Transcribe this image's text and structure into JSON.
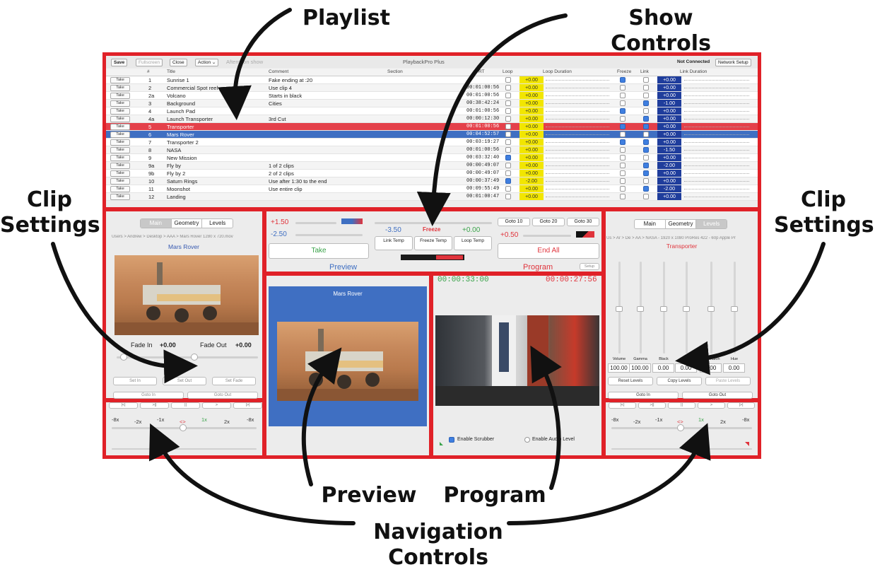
{
  "callouts": {
    "playlist": "Playlist",
    "show_controls": "Show Controls",
    "clip_settings_left": [
      "Clip",
      "Settings"
    ],
    "clip_settings_right": [
      "Clip",
      "Settings"
    ],
    "preview": "Preview",
    "program": "Program",
    "navigation_controls": [
      "Navigation",
      "Controls"
    ]
  },
  "toolbar": {
    "save": "Save",
    "fullscreen": "Fullscreen",
    "close": "Close",
    "action": "Action ⌄",
    "show_name": "Afternoon show",
    "app_title": "PlaybackPro Plus",
    "status": "Not Connected",
    "network_setup": "Network Setup"
  },
  "playlist": {
    "columns": [
      "#",
      "Title",
      "Comment",
      "Section",
      "TRT",
      "Loop",
      "Loop Duration",
      "Freeze",
      "Link",
      "Link Duration"
    ],
    "take_label": "Take",
    "rows": [
      {
        "num": "1",
        "title": "Sunrise 1",
        "comment": "Fake ending at :20",
        "trt": "",
        "loop": "+0.00",
        "link": "+0.00",
        "loop_on": false,
        "freeze": true,
        "link_on": false,
        "state": ""
      },
      {
        "num": "2",
        "title": "Commercial Spot reel",
        "comment": "Use clip 4",
        "trt": "00:01:00:56",
        "loop": "+0.00",
        "link": "+0.00",
        "loop_on": false,
        "freeze": false,
        "link_on": false,
        "state": ""
      },
      {
        "num": "2a",
        "title": "Volcano",
        "comment": "Starts in black",
        "trt": "00:01:00:56",
        "loop": "+0.00",
        "link": "+0.00",
        "loop_on": false,
        "freeze": false,
        "link_on": false,
        "state": ""
      },
      {
        "num": "3",
        "title": "Background",
        "comment": "Cities",
        "trt": "00:38:42:24",
        "loop": "+0.00",
        "link": "-1.00",
        "loop_on": false,
        "freeze": false,
        "link_on": true,
        "state": ""
      },
      {
        "num": "4",
        "title": "Launch Pad",
        "comment": "",
        "trt": "00:01:00:56",
        "loop": "+0.00",
        "link": "+0.00",
        "loop_on": false,
        "freeze": true,
        "link_on": false,
        "state": ""
      },
      {
        "num": "4a",
        "title": "Launch Transporter",
        "comment": "3rd Cut",
        "trt": "00:00:12:30",
        "loop": "+0.00",
        "link": "+0.00",
        "loop_on": false,
        "freeze": false,
        "link_on": true,
        "state": ""
      },
      {
        "num": "5",
        "title": "Transporter",
        "comment": "",
        "trt": "00:01:00:56",
        "loop": "+0.00",
        "link": "+0.00",
        "loop_on": false,
        "freeze": true,
        "link_on": true,
        "state": "red"
      },
      {
        "num": "6",
        "title": "Mars Rover",
        "comment": "",
        "trt": "00:04:52:57",
        "loop": "+0.00",
        "link": "+0.00",
        "loop_on": false,
        "freeze": false,
        "link_on": false,
        "state": "blue"
      },
      {
        "num": "7",
        "title": "Transporter 2",
        "comment": "",
        "trt": "00:03:19:27",
        "loop": "+0.00",
        "link": "+0.00",
        "loop_on": false,
        "freeze": true,
        "link_on": true,
        "state": ""
      },
      {
        "num": "8",
        "title": "NASA",
        "comment": "",
        "trt": "00:01:00:56",
        "loop": "+0.00",
        "link": "-1.50",
        "loop_on": false,
        "freeze": false,
        "link_on": true,
        "state": ""
      },
      {
        "num": "9",
        "title": "New Mission",
        "comment": "",
        "trt": "00:03:32:40",
        "loop": "+0.00",
        "link": "+0.00",
        "loop_on": true,
        "freeze": false,
        "link_on": false,
        "state": ""
      },
      {
        "num": "9a",
        "title": "Fly by",
        "comment": "1 of 2 clips",
        "trt": "00:00:49:07",
        "loop": "+0.00",
        "link": "-2.00",
        "loop_on": false,
        "freeze": false,
        "link_on": true,
        "state": ""
      },
      {
        "num": "9b",
        "title": "Fly by 2",
        "comment": "2 of 2 clips",
        "trt": "00:00:49:07",
        "loop": "+0.00",
        "link": "+0.00",
        "loop_on": false,
        "freeze": false,
        "link_on": true,
        "state": ""
      },
      {
        "num": "10",
        "title": "Saturn Rings",
        "comment": "Use after 1:30 to the end",
        "trt": "00:00:37:49",
        "loop": "-2.00",
        "link": "+0.00",
        "loop_on": true,
        "freeze": false,
        "link_on": false,
        "state": ""
      },
      {
        "num": "11",
        "title": "Moonshot",
        "comment": "Use entire clip",
        "trt": "00:09:55:49",
        "loop": "+0.00",
        "link": "-2.00",
        "loop_on": false,
        "freeze": false,
        "link_on": true,
        "state": ""
      },
      {
        "num": "12",
        "title": "Landing",
        "comment": "",
        "trt": "00:01:00:47",
        "loop": "+0.00",
        "link": "+0.00",
        "loop_on": false,
        "freeze": false,
        "link_on": false,
        "state": ""
      }
    ]
  },
  "left_clip": {
    "tabs": [
      "Main",
      "Geometry",
      "Levels"
    ],
    "path": "Users > Andrew > Desktop > AAA > Mars Rover 1280 x 720.mov",
    "clip_title": "Mars Rover",
    "fade_in_label": "Fade In",
    "fade_in_value": "+0.00",
    "fade_out_label": "Fade Out",
    "fade_out_value": "+0.00",
    "set_in": "Set In",
    "set_out": "Set Out",
    "set_fade": "Set Fade",
    "goto_in": "Goto In",
    "goto_out": "Goto Out"
  },
  "show_controls": {
    "preview_up": "+1.50",
    "preview_down": "-2.50",
    "take": "Take",
    "center_value_left": "-3.50",
    "freeze": "Freeze",
    "center_value_right": "+0.00",
    "link_temp": "Link Temp",
    "freeze_temp": "Freeze Temp",
    "loop_temp": "Loop Temp",
    "goto10": "Goto 10",
    "goto20": "Goto 20",
    "goto30": "Goto 30",
    "program_value": "+0.50",
    "end_all": "End All",
    "preview_label": "Preview",
    "program_label": "Program",
    "setup": "Setup"
  },
  "preview_panel": {
    "title": "Mars Rover"
  },
  "program_panel": {
    "elapsed": "00:00:33:00",
    "remaining": "00:00:27:56",
    "enable_scrubber": "Enable Scrubber",
    "enable_audio": "Enable Audio Level"
  },
  "right_clip": {
    "tabs": [
      "Main",
      "Geometry",
      "Levels"
    ],
    "path": "Us > Ar > De > AA > NASA - 1920 x 1080 ProRes 422 - 60p Apple Pr",
    "clip_title": "Transporter",
    "level_labels": [
      "Volume",
      "Gamma",
      "Black",
      "Gain",
      "Saturation",
      "Hue"
    ],
    "level_values": [
      "100.00",
      "100.00",
      "0.00",
      "0.00",
      "0.00",
      "0.00"
    ],
    "reset_levels": "Reset Levels",
    "copy_levels": "Copy Levels",
    "paste_levels": "Paste Levels",
    "goto_in": "Goto In",
    "goto_out": "Goto Out"
  },
  "nav_controls": {
    "transport": [
      "|<|",
      ">||",
      "||",
      ">",
      "|>|"
    ],
    "speeds": [
      "-8x",
      "-2x",
      "-1x",
      "<>",
      "1x",
      "2x",
      "-8x"
    ]
  },
  "colors": {
    "highlight_red": "#e02128",
    "selected_blue": "#3f6fc2",
    "loop_yellow": "#f2e600",
    "link_navy": "#1f3d9c",
    "timecode_green": "#3aa34a",
    "timecode_red": "#e0343c"
  }
}
